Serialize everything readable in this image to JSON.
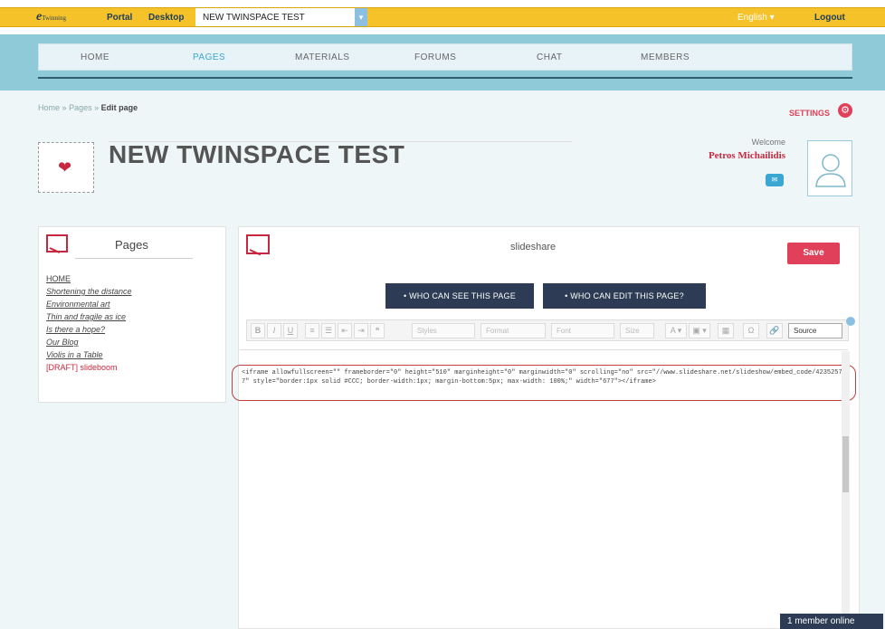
{
  "topbar": {
    "logo_main": "e",
    "logo_small": "Twinning",
    "portal": "Portal",
    "desktop": "Desktop",
    "twinspace_title": "NEW TWINSPACE TEST",
    "dropdown": "▾",
    "language": "English ▾",
    "logout": "Logout"
  },
  "nav": {
    "items": [
      "HOME",
      "PAGES",
      "MATERIALS",
      "FORUMS",
      "CHAT",
      "MEMBERS"
    ],
    "active": "PAGES"
  },
  "breadcrumb": {
    "home": "Home",
    "sep1": "»",
    "pages": "Pages",
    "sep2": "»",
    "current": "Edit page"
  },
  "settings": {
    "label": "SETTINGS",
    "icon": "⚙"
  },
  "header": {
    "title": "NEW TWINSPACE TEST",
    "welcome": "Welcome",
    "user_name": "Petros Michailidis",
    "chat_badge": "✉"
  },
  "pages_panel": {
    "heading": "Pages",
    "items": [
      "HOME",
      "Shortening the distance",
      "Environmental art",
      "Thin and fragile as ice",
      "Is there a hope?",
      "Our Blog",
      "Violis in a Table",
      "[DRAFT] slideboom"
    ]
  },
  "editor": {
    "page_name": "slideshare",
    "save_label": "Save",
    "who_can_see": "• WHO CAN SEE THIS PAGE",
    "who_can_edit": "• WHO CAN EDIT THIS PAGE?",
    "toolbar": {
      "bold": "B",
      "italic": "I",
      "underline": "U",
      "ol": "≡",
      "ul": "☰",
      "outdent": "⇤",
      "indent": "⇥",
      "quote": "❝",
      "styles": "Styles",
      "format": "Format",
      "font": "Font",
      "size": "Size",
      "color": "A ▾",
      "bgcolor": "▣ ▾",
      "table": "▦",
      "special": "Ω",
      "link": "🔗",
      "source": "Source"
    },
    "source_code": "<iframe allowfullscreen=\"\" frameborder=\"0\" height=\"510\" marginheight=\"0\" marginwidth=\"0\" scrolling=\"no\" src=\"//www.slideshare.net/slideshow/embed_code/42352577\" style=\"border:1px solid #CCC; border-width:1px; margin-bottom:5px; max-width: 100%;\" width=\"677\"></iframe>"
  },
  "footer": {
    "online": "1 member online"
  },
  "colors": {
    "topbar": "#f5c22a",
    "nav_band": "#8fcad9",
    "accent_red": "#e0405a",
    "navy": "#2d3c54",
    "link_blue": "#3aa6d4"
  }
}
